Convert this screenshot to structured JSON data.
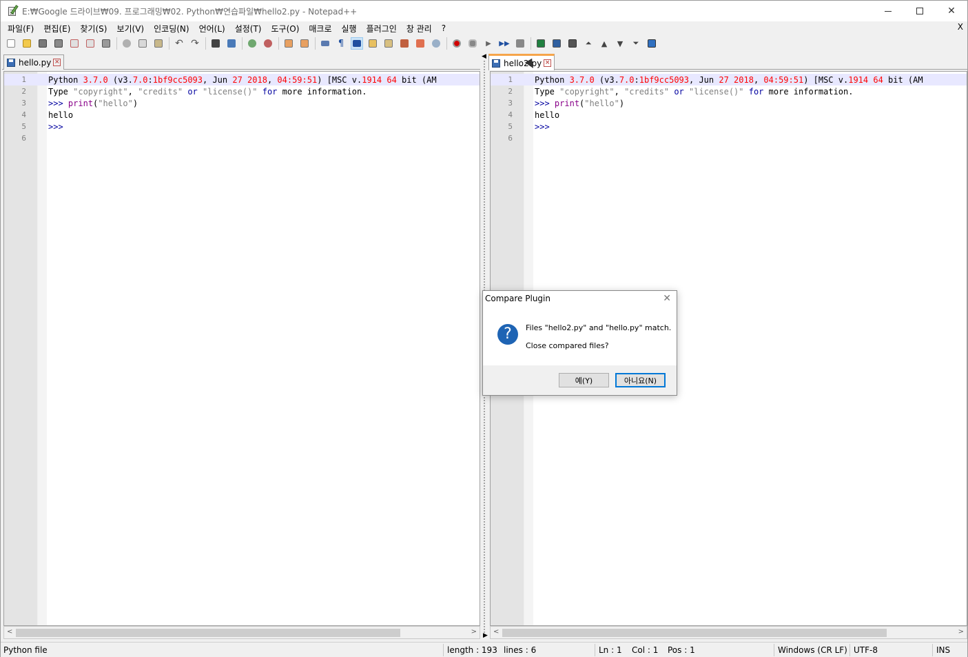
{
  "window": {
    "title": "E:₩Google 드라이브₩09. 프로그래밍₩02. Python₩연습파일₩hello2.py - Notepad++"
  },
  "menu": {
    "items": [
      "파일(F)",
      "편집(E)",
      "찾기(S)",
      "보기(V)",
      "인코딩(N)",
      "언어(L)",
      "설정(T)",
      "도구(O)",
      "매크로",
      "실행",
      "플러그인",
      "창 관리",
      "?"
    ],
    "close_label": "X"
  },
  "toolbar": {
    "icons": [
      "new-file-icon",
      "open-file-icon",
      "save-icon",
      "save-all-icon",
      "close-icon",
      "close-all-icon",
      "print-icon",
      "cut-icon",
      "copy-icon",
      "paste-icon",
      "undo-icon",
      "redo-icon",
      "find-icon",
      "replace-icon",
      "zoom-in-icon",
      "zoom-out-icon",
      "sync-vertical-icon",
      "sync-horizontal-icon",
      "word-wrap-icon",
      "show-all-chars-icon",
      "indent-guide-icon",
      "udl-icon",
      "doc-map-icon",
      "function-list-icon",
      "folder-workspace-icon",
      "monitoring-icon",
      "record-macro-icon",
      "stop-macro-icon",
      "play-macro-icon",
      "run-macro-multiple-icon",
      "save-macro-icon",
      "compare-icon",
      "clear-compare-icon",
      "compare-lines-icon",
      "first-diff-icon",
      "prev-diff-icon",
      "next-diff-icon",
      "last-diff-icon",
      "navigation-bar-icon"
    ]
  },
  "left_pane": {
    "tab": {
      "label": "hello.py"
    },
    "lines": [
      {
        "num": "1",
        "text": "Python 3.7.0 (v3.7.0:1bf9cc5093, Jun 27 2018, 04:59:51) [MSC v.1914 64 bit (AM"
      },
      {
        "num": "2",
        "text": "Type \"copyright\", \"credits\" or \"license()\" for more information."
      },
      {
        "num": "3",
        "text": ">>> print(\"hello\")"
      },
      {
        "num": "4",
        "text": "hello"
      },
      {
        "num": "5",
        "text": ">>>"
      },
      {
        "num": "6",
        "text": ""
      }
    ]
  },
  "right_pane": {
    "tab": {
      "label": "hello2.py"
    },
    "lines": [
      {
        "num": "1",
        "text": "Python 3.7.0 (v3.7.0:1bf9cc5093, Jun 27 2018, 04:59:51) [MSC v.1914 64 bit (AM"
      },
      {
        "num": "2",
        "text": "Type \"copyright\", \"credits\" or \"license()\" for more information."
      },
      {
        "num": "3",
        "text": ">>> print(\"hello\")"
      },
      {
        "num": "4",
        "text": "hello"
      },
      {
        "num": "5",
        "text": ">>>"
      },
      {
        "num": "6",
        "text": ""
      }
    ]
  },
  "statusbar": {
    "filetype": "Python file",
    "length": "length : 193",
    "lines": "lines : 6",
    "ln": "Ln : 1",
    "col": "Col : 1",
    "pos": "Pos : 1",
    "eol": "Windows (CR LF)",
    "encoding": "UTF-8",
    "mode": "INS"
  },
  "dialog": {
    "title": "Compare Plugin",
    "message_line1": "Files \"hello2.py\" and \"hello.py\" match.",
    "message_line2": "Close compared files?",
    "yes_label": "예(Y)",
    "no_label": "아니요(N)",
    "icon_glyph": "?"
  },
  "colors": {
    "keyword": "#00009f",
    "number": "#ff0000",
    "string": "#808080",
    "builtin": "#880088",
    "current_line": "#e8e8ff",
    "active_tab_accent": "#f6a54a"
  }
}
